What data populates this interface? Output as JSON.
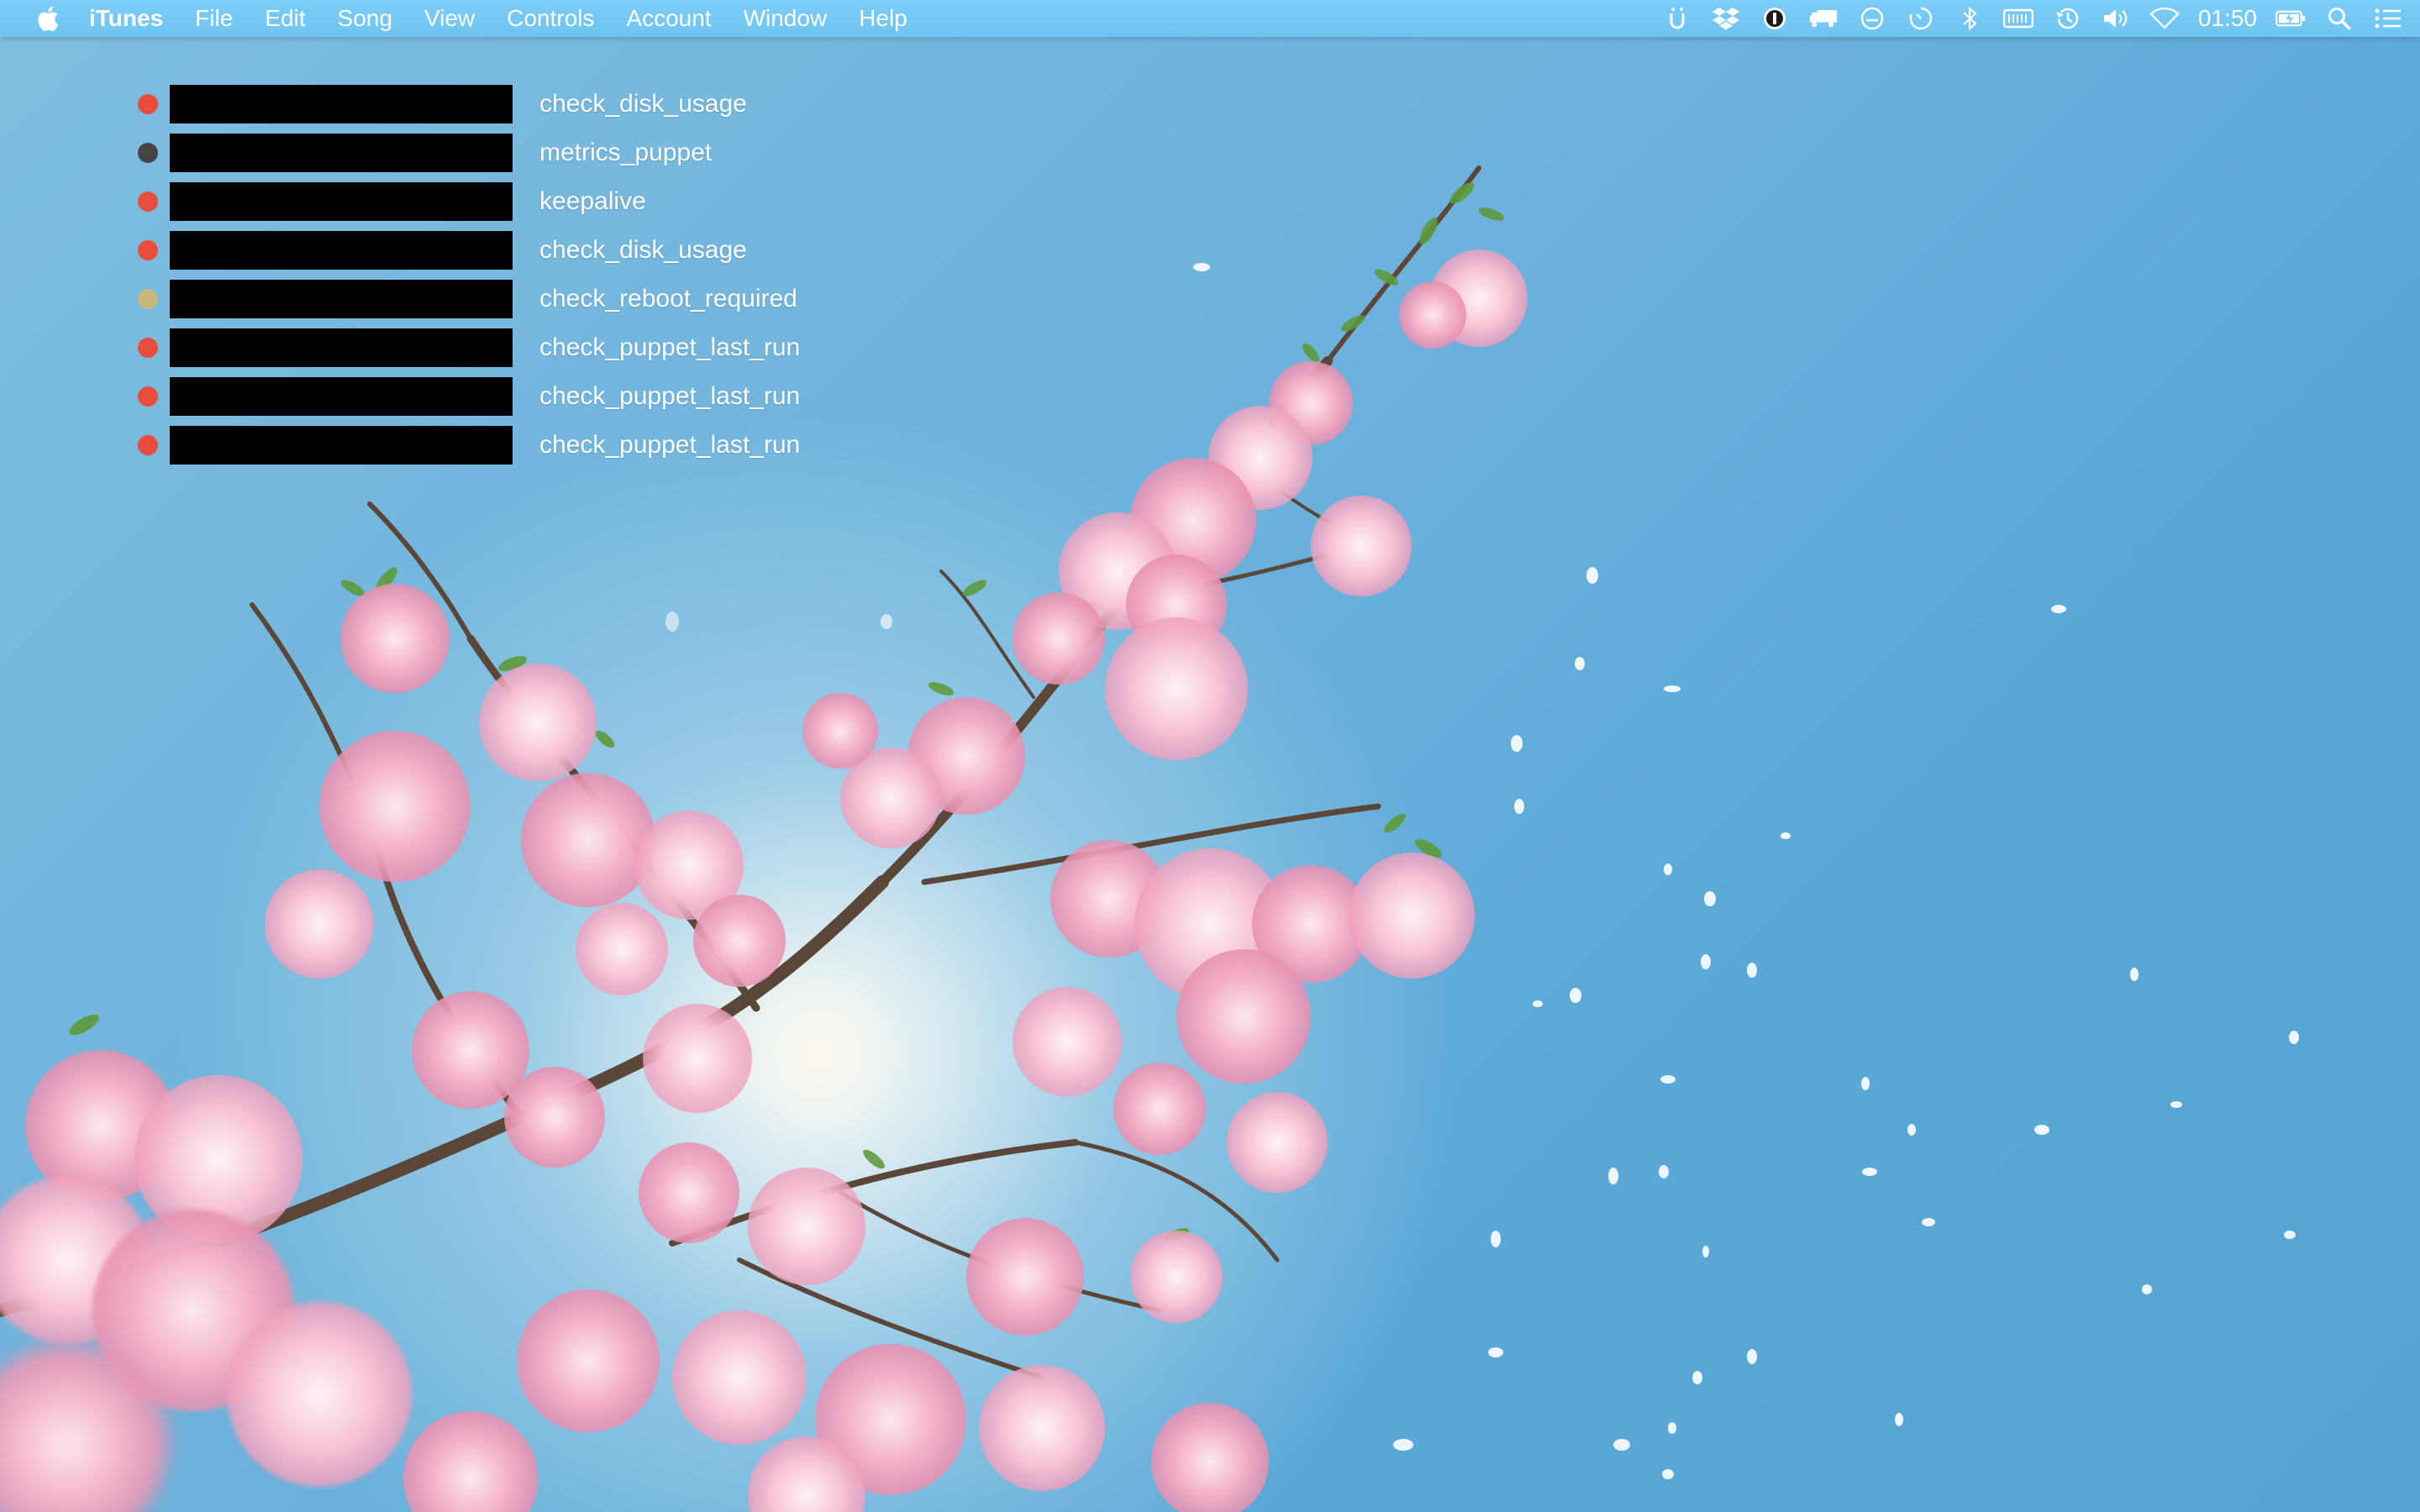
{
  "menubar": {
    "app_name": "iTunes",
    "menus": [
      "File",
      "Edit",
      "Song",
      "View",
      "Controls",
      "Account",
      "Window",
      "Help"
    ],
    "clock": "01:50",
    "status_icons": [
      "ubersicht-icon",
      "dropbox-icon",
      "onepassword-icon",
      "transmit-truck-icon",
      "gauge-icon",
      "timer-icon",
      "bluetooth-icon",
      "keyboard-icon",
      "time-machine-icon",
      "volume-icon",
      "wifi-icon",
      "battery-icon",
      "spotlight-icon",
      "notification-center-icon"
    ]
  },
  "checks": [
    {
      "name": "check_disk_usage",
      "status_color": "#e74c3c"
    },
    {
      "name": "metrics_puppet",
      "status_color": "#444444"
    },
    {
      "name": "keepalive",
      "status_color": "#e74c3c"
    },
    {
      "name": "check_disk_usage",
      "status_color": "#e74c3c"
    },
    {
      "name": "check_reboot_required",
      "status_color": "#c8b97a"
    },
    {
      "name": "check_puppet_last_run",
      "status_color": "#e74c3c"
    },
    {
      "name": "check_puppet_last_run",
      "status_color": "#e74c3c"
    },
    {
      "name": "check_puppet_last_run",
      "status_color": "#e74c3c"
    }
  ],
  "colors": {
    "menubar": "#74c8f4",
    "sky": "#6db3dc",
    "blossom": "#f2a9c4",
    "redaction": "#000000"
  }
}
